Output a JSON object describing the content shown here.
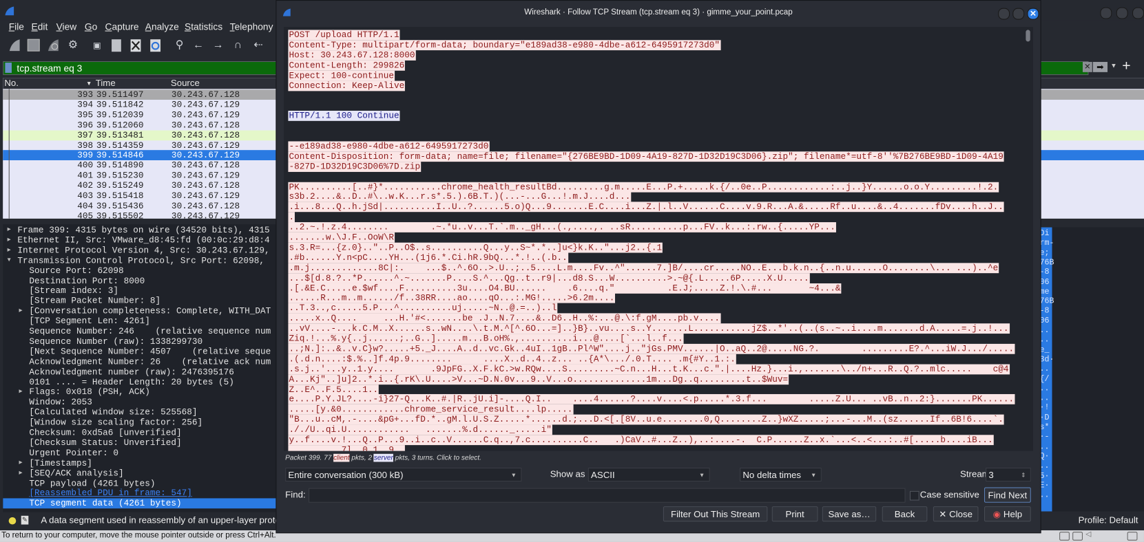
{
  "main": {
    "menu": [
      "File",
      "Edit",
      "View",
      "Go",
      "Capture",
      "Analyze",
      "Statistics",
      "Telephony"
    ],
    "toolbar_icons": [
      "start-capture-icon",
      "stop-capture-icon",
      "restart-capture-icon",
      "capture-options-icon",
      "open-file-icon",
      "save-file-icon",
      "close-file-icon",
      "reload-file-icon",
      "find-packet-icon",
      "go-back-icon",
      "go-forward-icon",
      "go-to-packet-icon",
      "first-packet-icon"
    ],
    "filter": {
      "value": "tcp.stream eq 3",
      "color": "#0b6a0b"
    },
    "packet_list": {
      "columns": [
        "No.",
        "Time",
        "Source"
      ],
      "rows": [
        {
          "no": "393",
          "time": "39.511497",
          "source": "30.243.67.128",
          "color": "#a9a9ab"
        },
        {
          "no": "394",
          "time": "39.511842",
          "source": "30.243.67.129",
          "color": "#e6e7f7"
        },
        {
          "no": "395",
          "time": "39.512039",
          "source": "30.243.67.129",
          "color": "#e6e7f7"
        },
        {
          "no": "396",
          "time": "39.512060",
          "source": "30.243.67.128",
          "color": "#e6e7f7"
        },
        {
          "no": "397",
          "time": "39.513481",
          "source": "30.243.67.128",
          "color": "#e4f7c9"
        },
        {
          "no": "398",
          "time": "39.514359",
          "source": "30.243.67.129",
          "color": "#e6e7f7"
        },
        {
          "no": "399",
          "time": "39.514846",
          "source": "30.243.67.129",
          "color": "#2a7ae2",
          "selected": true
        },
        {
          "no": "400",
          "time": "39.514890",
          "source": "30.243.67.128",
          "color": "#e6e7f7"
        },
        {
          "no": "401",
          "time": "39.515230",
          "source": "30.243.67.129",
          "color": "#e6e7f7"
        },
        {
          "no": "402",
          "time": "39.515249",
          "source": "30.243.67.128",
          "color": "#e6e7f7"
        },
        {
          "no": "403",
          "time": "39.515418",
          "source": "30.243.67.129",
          "color": "#e6e7f7"
        },
        {
          "no": "404",
          "time": "39.515436",
          "source": "30.243.67.128",
          "color": "#e6e7f7"
        },
        {
          "no": "405",
          "time": "39.515502",
          "source": "30.243.67.129",
          "color": "#e6e7f7"
        }
      ]
    },
    "details": [
      {
        "t": "Frame 399: 4315 bytes on wire (34520 bits), 4315",
        "lvl": 0,
        "exp": "closed"
      },
      {
        "t": "Ethernet II, Src: VMware_d8:45:fd (00:0c:29:d8:4",
        "lvl": 0,
        "exp": "closed"
      },
      {
        "t": "Internet Protocol Version 4, Src: 30.243.67.129,",
        "lvl": 0,
        "exp": "closed"
      },
      {
        "t": "Transmission Control Protocol, Src Port: 62098,",
        "lvl": 0,
        "exp": "open"
      },
      {
        "t": "Source Port: 62098",
        "lvl": 1
      },
      {
        "t": "Destination Port: 8000",
        "lvl": 1
      },
      {
        "t": "[Stream index: 3]",
        "lvl": 1
      },
      {
        "t": "[Stream Packet Number: 8]",
        "lvl": 1
      },
      {
        "t": "[Conversation completeness: Complete, WITH_DAT",
        "lvl": 1,
        "exp": "closed"
      },
      {
        "t": "[TCP Segment Len: 4261]",
        "lvl": 1
      },
      {
        "t": "Sequence Number: 246    (relative sequence num",
        "lvl": 1
      },
      {
        "t": "Sequence Number (raw): 1338299730",
        "lvl": 1
      },
      {
        "t": "[Next Sequence Number: 4507    (relative seque",
        "lvl": 1
      },
      {
        "t": "Acknowledgment Number: 26    (relative ack num",
        "lvl": 1
      },
      {
        "t": "Acknowledgment number (raw): 2476395176",
        "lvl": 1
      },
      {
        "t": "0101 .... = Header Length: 20 bytes (5)",
        "lvl": 1
      },
      {
        "t": "Flags: 0x018 (PSH, ACK)",
        "lvl": 1,
        "exp": "closed"
      },
      {
        "t": "Window: 2053",
        "lvl": 1
      },
      {
        "t": "[Calculated window size: 525568]",
        "lvl": 1
      },
      {
        "t": "[Window size scaling factor: 256]",
        "lvl": 1
      },
      {
        "t": "Checksum: 0xd5a6 [unverified]",
        "lvl": 1
      },
      {
        "t": "[Checksum Status: Unverified]",
        "lvl": 1
      },
      {
        "t": "Urgent Pointer: 0",
        "lvl": 1
      },
      {
        "t": "[Timestamps]",
        "lvl": 1,
        "exp": "closed"
      },
      {
        "t": "[SEQ/ACK analysis]",
        "lvl": 1,
        "exp": "closed"
      },
      {
        "t": "TCP payload (4261 bytes)",
        "lvl": 1
      },
      {
        "t": "[Reassembled PDU in frame: 547]",
        "lvl": 1,
        "link": true
      },
      {
        "t": "TCP segment data (4261 bytes)",
        "lvl": 1,
        "selected": true
      }
    ],
    "bytes_column": [
      "Di",
      "rm-",
      "e;",
      "76B",
      "-8",
      "06",
      "me",
      "76B",
      "-8",
      "06",
      "..",
      "..",
      "e_",
      "3d·",
      "..",
      "{/",
      "..",
      "..",
      "·!",
      "·D",
      "s*",
      "·-",
      "..",
      "Q·",
      "..",
      "5·",
      "E·",
      ".."
    ],
    "status_text": "A data segment used in reassembly of an upper-layer proto",
    "profile": "Profile: Default"
  },
  "vm_message": "To return to your computer, move the mouse pointer outside or press Ctrl+Alt.",
  "dialog": {
    "title": "Wireshark · Follow TCP Stream (tcp.stream eq 3) · gimme_your_point.pcap",
    "client_color": "#8c1a1a",
    "server_color": "#1c1c8a",
    "stream_lines": [
      {
        "d": "c",
        "t": "POST /upload HTTP/1.1"
      },
      {
        "d": "c",
        "t": "Content-Type: multipart/form-data; boundary=\"e189ad38-e980-4dbe-a612-6495917273d0\""
      },
      {
        "d": "c",
        "t": "Host: 30.243.67.128:8000"
      },
      {
        "d": "c",
        "t": "Content-Length: 299826"
      },
      {
        "d": "c",
        "t": "Expect: 100-continue"
      },
      {
        "d": "c",
        "t": "Connection: Keep-Alive"
      },
      {
        "d": "b",
        "t": ""
      },
      {
        "d": "b",
        "t": ""
      },
      {
        "d": "s",
        "t": "HTTP/1.1 100 Continue"
      },
      {
        "d": "b",
        "t": ""
      },
      {
        "d": "b",
        "t": ""
      },
      {
        "d": "c",
        "t": "--e189ad38-e980-4dbe-a612-6495917273d0"
      },
      {
        "d": "c",
        "t": "Content-Disposition: form-data; name=file; filename=\"{276BE9BD-1D09-4A19-827D-1D32D19C3D06}.zip\"; filename*=utf-8''%7B276BE9BD-1D09-4A19"
      },
      {
        "d": "c",
        "t": "-827D-1D32D19C3D06%7D.zip"
      },
      {
        "d": "b",
        "t": ""
      },
      {
        "d": "c",
        "t": "PK..........[..#}*...........chrome_health_resultBd.........g.m.....E...P.+.....k.{/..0e..P............:..j..}Y......o.o.Y.........!.2."
      },
      {
        "d": "c",
        "t": "s3b.2....&..D..#\\..w.K...r.s*.5.).6B.T.)(...-...G...!.m.J....d..."
      },
      {
        "d": "c",
        "t": ".i...8...Q..h.jSd|..........I..U..?......5.o)Q...9.......E.C....i...Z.|.l..V......C....v.9.R...A.&.....Rf..u....&..4.......fDv....h..J.."
      },
      {
        "d": "c",
        "t": "."
      },
      {
        "d": "c",
        "t": "..2.~.!.z.4........        .~.*u..v...T.`.m.._gH...(.,....,. ..sR..........p...FV..k...:.rw..{.....YP..."
      },
      {
        "d": "c",
        "t": ".......w.\\J.F..OoW\\R"
      },
      {
        "d": "c",
        "t": "s.3.R=...{z.0}..\"..P..O$..s..........Q...y..S~*.*..]u<}k.K..\"...j2..{.1"
      },
      {
        "d": "c",
        "t": ".#b......Y.n<pC....YH...(1j6.*.Ci.hR.9bQ...*.!..(.b.."
      },
      {
        "d": "c",
        "t": ".m.j.............8C|:.    ...$..^.6O..>.U..;..5....L.m....Fv..^\"......7.]B/....cr.....NO..E...b.k.n..{..n.u......O........\\... ...)..^e"
      },
      {
        "d": "c",
        "t": "...$[d.8.?..*P......^.~.......P....S.^...Qg..t..r9|...d8.S...W..........>.~@{.L.....6P.....X.U....."
      },
      {
        "d": "c",
        "t": ".[.&E.C.....e.$wf....F..........3u....O4.BU......    .6....q.\"          .E.J;.....Z.!.\\.#...       ~4...&"
      },
      {
        "d": "c",
        "t": "......R...m..m....../f..38RR....ao....qO...:.MG!.....>6.2m...."
      },
      {
        "d": "c",
        "t": "..T.3..,c.....5.P...^..........uj.....~N..@.=..)..l"
      },
      {
        "d": "c",
        "t": ".....x..Q....     ...H.'#<.......be .J..N.7....&..D6..H..%:...@.\\:f.gM....pb.v...."
      },
      {
        "d": "c",
        "t": "..vV....-...k.C.M..X......s..wN....\\.t.M.^[^.6O...=]..}B}..vu....s..Y.......L...........jZ$..*'..(..(s..~..i....m.......d.A.....=.j..!..."
      },
      {
        "d": "c",
        "t": "Ziq.!...%.y{..j......;..G..].....m...B.oH%.,..........i...@....[`...l..f..."
      },
      {
        "d": "c",
        "t": "..;N.]:..&..v.C}w?.....+5._J....A..d..vc.Gk..4uI..1gB..Pl^W\"....j..\"jGs.PMV......|O..aQ..2@.....NG.?.        .........E?.^...iW.J.../....."
      },
      {
        "d": "c",
        "t": ".(.d.n....:$.%..]f.4p.9........      ....X..d..4..z... ..{A*\\.../.0.T.... .m{#Y..1.:."
      },
      {
        "d": "c",
        "t": ".s.j..'...y..1.y....       .9JpFG..X.F.kC.>w.RQw....S.........~C.n...H...t.K...c.\".|....Hz.}...i.,.......\\../n+...R..Q.?..mlc.....    c@4"
      },
      {
        "d": "c",
        "t": "A...Kj\"..]u]2..*.i..{.rK\\.U....>V...~D.N.0v...9..V...o..............1m...Dg..q.........t..$Wuv="
      },
      {
        "d": "c",
        "t": "Z..E^..F.5....1.."
      },
      {
        "d": "c",
        "t": "e....P.Y.JL?....-i}27-Q...K..#.|R..jU.i]-....Q.I..    ....4......?....v....<.p.....*.3.f...        .....Z.U... ..vB..n..2:}.......PK......"
      },
      {
        "d": "c",
        "t": ".....[y.&0............chrome_service_result....lp....."
      },
      {
        "d": "c",
        "t": "\"B...u..cM,.-....&pG+...fD.*..gM.l.U.S.Z.....*......d.;...D.<[.[8V..u.e........0,Q........Z..}wXZ.....;...-...M..(sz......If..6B!6....`."
      },
      {
        "d": "c",
        "t": "././U..qi.U............   .......%.d......_.....i\""
      },
      {
        "d": "c",
        "t": "y..f....v.!...Q..P...9..i..c..V......C.q..,7.c..........C..   .)CaV..#...Z..),..:....-.  C.P......Z..x.`...<..<...:..#[.....b....iB..."
      },
      {
        "d": "c",
        "t": "..........7l..0.1..9.."
      }
    ],
    "packet_info": {
      "prefix": "Packet 399. 77 ",
      "client": "client",
      "mid": " pkts, 2 ",
      "server": "server",
      "suffix": " pkts, 3 turns. Click to select."
    },
    "conversation": "Entire conversation (300 kB)",
    "show_as_label": "Show as",
    "show_as": "ASCII",
    "delta": "No delta times",
    "stream_label": "Stream",
    "stream_value": "3",
    "find_label": "Find:",
    "find_value": "",
    "case_sensitive": "Case sensitive",
    "case_checked": false,
    "buttons": {
      "find_next": "Find Next",
      "filter_out": "Filter Out This Stream",
      "print": "Print",
      "save_as": "Save as…",
      "back": "Back",
      "close": "✕ Close",
      "help": "Help"
    }
  }
}
